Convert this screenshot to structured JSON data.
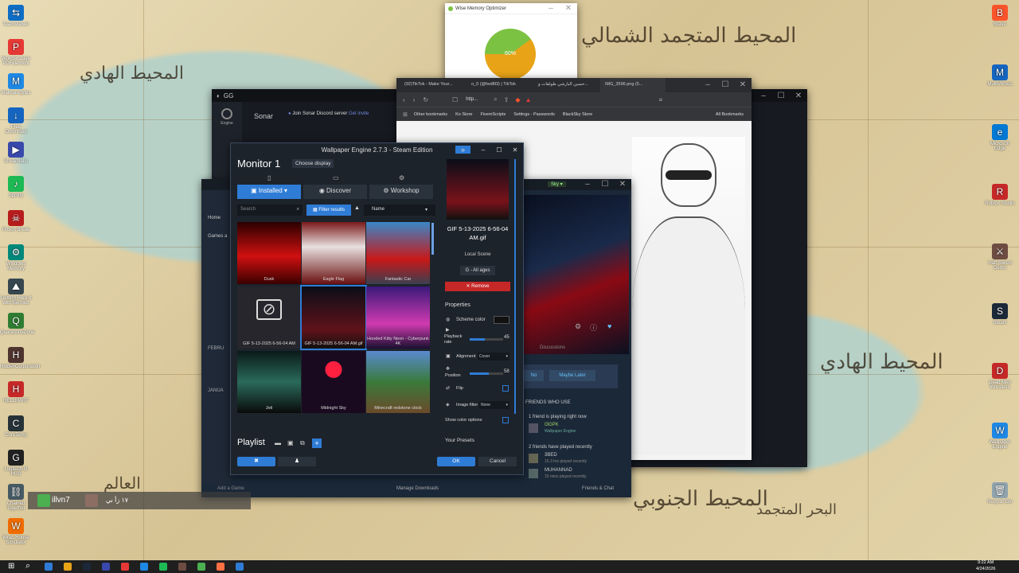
{
  "wallpaper": {
    "arabic_texts": [
      "المحيط المتجمد الشمالي",
      "المحيط الهادي",
      "المحيط الهادي",
      "العالم",
      "المحيط الجنوبي",
      "البحر المتجمد"
    ]
  },
  "desktop_icons_left": [
    {
      "label": "TeamViewer",
      "color": "#0e6dc5",
      "glyph": "⇆"
    },
    {
      "label": "Wondershare PDFelement",
      "color": "#e53935",
      "glyph": "P"
    },
    {
      "label": "Malwarebytes",
      "color": "#1e88e5",
      "glyph": "M"
    },
    {
      "label": "Free Download",
      "color": "#1565c0",
      "glyph": "↓"
    },
    {
      "label": "Streamlabs",
      "color": "#3949ab",
      "glyph": "▶"
    },
    {
      "label": "Spotify",
      "color": "#1db954",
      "glyph": "♪"
    },
    {
      "label": "Prison Break",
      "color": "#b71c1c",
      "glyph": "☠"
    },
    {
      "label": "Windows Memory",
      "color": "#00897b",
      "glyph": "⚙"
    },
    {
      "label": "Getting Here It with Bennett",
      "color": "#37474f",
      "glyph": "⛰"
    },
    {
      "label": "QuarantineZone",
      "color": "#2e7d32",
      "glyph": "Q"
    },
    {
      "label": "HiddenCorporation",
      "color": "#4e342e",
      "glyph": "H"
    },
    {
      "label": "HELLMART",
      "color": "#c62828",
      "glyph": "H"
    },
    {
      "label": "CoreTemp",
      "color": "#263238",
      "glyph": "C"
    },
    {
      "label": "Logitech G HUB",
      "color": "#212121",
      "glyph": "G"
    },
    {
      "label": "Chained Together",
      "color": "#455a64",
      "glyph": "⛓"
    },
    {
      "label": "Wrap House Simulator",
      "color": "#ef6c00",
      "glyph": "W"
    }
  ],
  "desktop_icons_right": [
    {
      "label": "Brave",
      "color": "#fb542b",
      "glyph": "B"
    },
    {
      "label": "MultiVersus",
      "color": "#1565c0",
      "glyph": "M"
    },
    {
      "label": "Microsoft Edge",
      "color": "#0078d4",
      "glyph": "e"
    },
    {
      "label": "Roblox Studio",
      "color": "#c62828",
      "glyph": "R"
    },
    {
      "label": "Half Sword Demo",
      "color": "#6d4c41",
      "glyph": "⚔"
    },
    {
      "label": "Steam",
      "color": "#1b2838",
      "glyph": "S"
    },
    {
      "label": "Dead Men Wrestlers",
      "color": "#c62828",
      "glyph": "D"
    },
    {
      "label": "Wallpaper Engine",
      "color": "#1e88e5",
      "glyph": "W"
    },
    {
      "label": "Recycle Bin",
      "color": "#90a4ae",
      "glyph": "🗑"
    }
  ],
  "memory_optimizer": {
    "title": "Wise Memory Optimizer",
    "percent_label": "60%",
    "percent": 60,
    "used_color": "#e8a317",
    "free_color": "#7cc242"
  },
  "gg": {
    "title": "GG",
    "engine_label": "Engine",
    "sonar_label": "Sonar",
    "discord_text": "Join Sonar Discord server",
    "discord_link": "Get invite"
  },
  "browser": {
    "tabs": [
      "(92)TikTok - Make Your...",
      "o_0 (@fwd8l3) | TikTok",
      "حسين البارشي طولقات و...",
      "IMG_3596.png (5..."
    ],
    "url": "http...",
    "bookmarks": [
      "Other bookmarks",
      "Ko Store",
      "FivemScripts",
      "Settings - Passwords",
      "BlackSky Store"
    ],
    "all_bookmarks": "All Bookmarks"
  },
  "steam": {
    "home": "Home",
    "games_label": "Games a",
    "section_feb": "FEBRU",
    "section_jan": "JANUA",
    "add_game": "Add a Game",
    "manage_downloads": "Manage Downloads",
    "friends_chat": "Friends & Chat",
    "discussions": "Discussions",
    "no_label": "No",
    "maybe_later": "Maybe Later",
    "friends_who_use": "FRIENDS WHO USE",
    "playing_now": "1 friend is playing right now",
    "played_recently": "2 friends have played recently",
    "friends": [
      {
        "name": "I3GPK",
        "status": "Wallpaper Engine"
      },
      {
        "name": "3BED",
        "status": "15.3 hrs played recently"
      },
      {
        "name": "MUHANNAD",
        "status": "15 mins played recently"
      }
    ]
  },
  "wallpaper_engine": {
    "title": "Wallpaper Engine 2.7.3 - Steam Edition",
    "monitor": "Monitor 1",
    "choose_display": "Choose display",
    "tabs": [
      "Installed",
      "Discover",
      "Workshop"
    ],
    "search_placeholder": "Search",
    "filter_results": "Filter results",
    "sort": "Name",
    "tiles": [
      {
        "label": "Dusk",
        "bg": "linear-gradient(#2a0000,#d01010 55%,#3a0000)"
      },
      {
        "label": "Eagle Flag",
        "bg": "linear-gradient(#7a1a1a,#e8e0e0 40%,#6a1010)"
      },
      {
        "label": "Fantastic Car",
        "bg": "linear-gradient(#3a86c8,#c81818 60%,#3a4050)"
      },
      {
        "label": "GIF 5-13-2025 6-56-04 AM",
        "bg": "#26262c"
      },
      {
        "label": "GIF 5-13-2025 6-56-04 AM.gif",
        "bg": "linear-gradient(#0a0e18,#60121a 70%,#111)"
      },
      {
        "label": "Hooded Kitty Neon - Cyberpunk 4K",
        "bg": "linear-gradient(#3a1a7a,#d03ab0 60%,#1a1030)"
      },
      {
        "label": "Jeti",
        "bg": "linear-gradient(#0a1a18,#2a6a5a 50%,#0a0a0a)"
      },
      {
        "label": "Midnight Sky",
        "bg": "radial-gradient(circle at 50% 30%,#ff2040 0,#ff2040 15%,#1a0a20 16%)"
      },
      {
        "label": "Minecraft redstone clock",
        "bg": "linear-gradient(#5a8ad0,#3a7a3a 50%,#6a4a2a)"
      }
    ],
    "preview_title": "GIF 5-13-2025 6-56-04 AM.gif",
    "local_scene": "Local Scene",
    "rating": "G - All ages",
    "remove": "✕ Remove",
    "properties": "Properties",
    "scheme_color": "Scheme color",
    "playback_rate": "Playback rate",
    "playback_value": "45",
    "alignment": "Alignment",
    "alignment_value": "Cover",
    "position": "Position",
    "position_value": "58",
    "flip": "Flip",
    "image_filter": "Image filter",
    "image_filter_value": "None",
    "show_color_options": "Show color options",
    "your_presets": "Your Presets",
    "playlist": "Playlist",
    "ok": "OK",
    "cancel": "Cancel"
  },
  "tray_user": {
    "name": "illvn7",
    "subtitle": "١٧ زأ ني"
  },
  "taskbar": {
    "time": "9:22 AM",
    "date": "4/24/2026"
  }
}
